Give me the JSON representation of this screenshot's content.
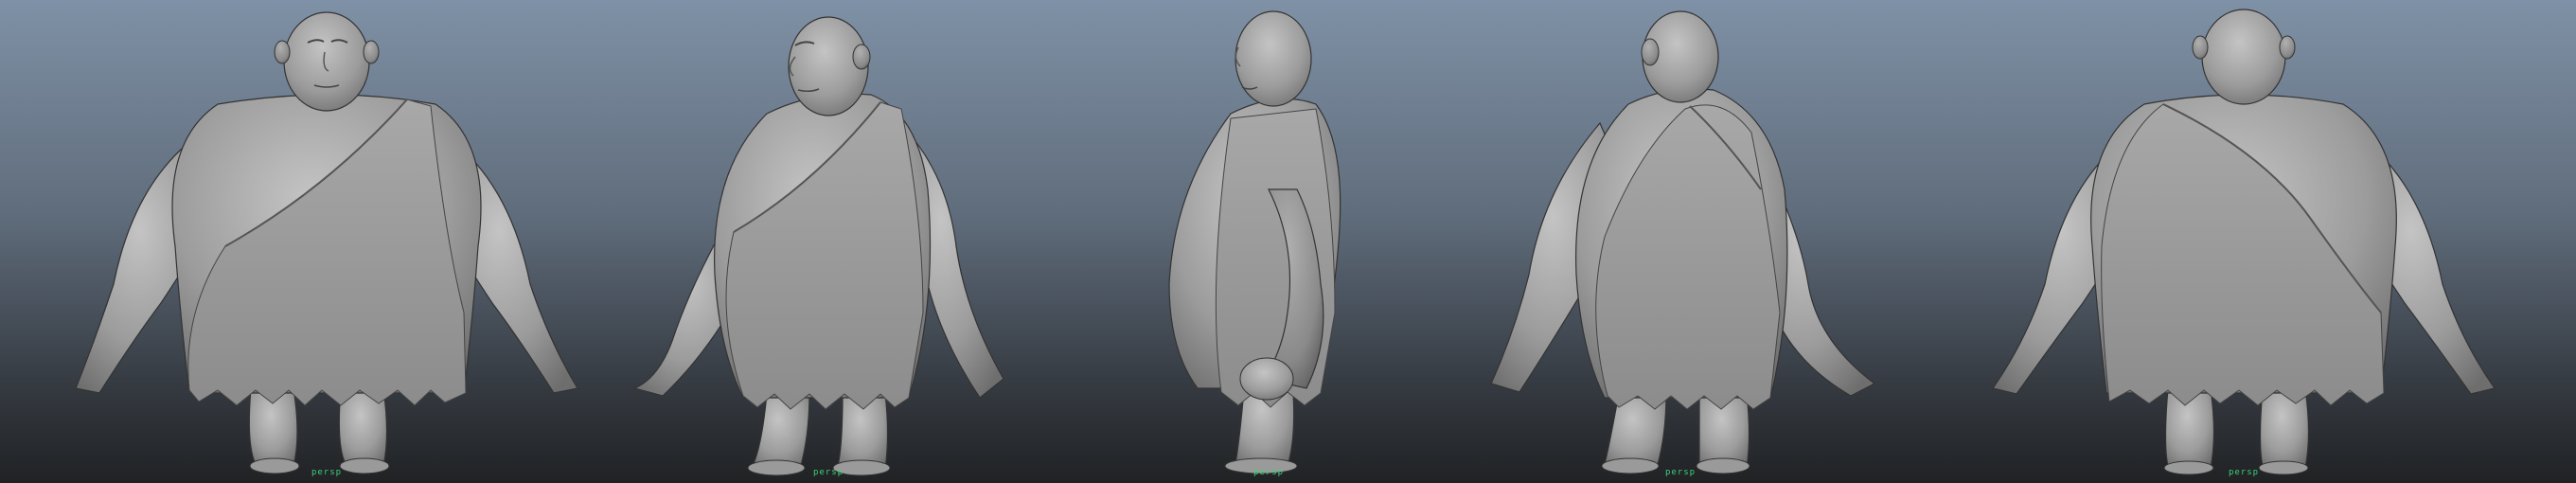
{
  "viewport": {
    "background_top": "#7f91a6",
    "background_bottom": "#202224",
    "model_color": "#a4a4a4",
    "outline_color": "#333333",
    "pivot_color": "#3fd07a"
  },
  "views": [
    {
      "id": "front",
      "pivot_label": "persp"
    },
    {
      "id": "three-quarter-left",
      "pivot_label": "persp"
    },
    {
      "id": "side",
      "pivot_label": "persp"
    },
    {
      "id": "three-quarter-back",
      "pivot_label": "persp"
    },
    {
      "id": "back",
      "pivot_label": "persp"
    }
  ]
}
